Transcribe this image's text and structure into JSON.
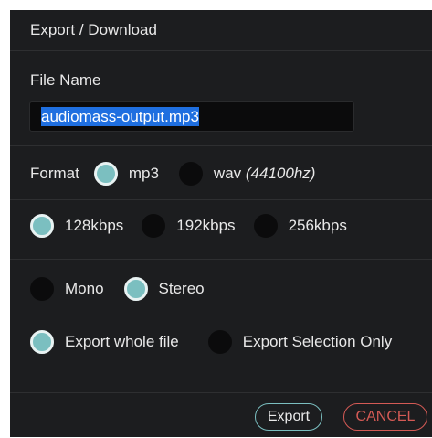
{
  "dialog": {
    "title": "Export / Download"
  },
  "file_name": {
    "label": "File Name",
    "value": "audiomass-output.mp3"
  },
  "format": {
    "label": "Format",
    "options": [
      {
        "label": "mp3",
        "selected": true
      },
      {
        "label": "wav",
        "suffix": "(44100hz)",
        "selected": false
      }
    ]
  },
  "bitrate": {
    "options": [
      {
        "label": "128kbps",
        "selected": true
      },
      {
        "label": "192kbps",
        "selected": false
      },
      {
        "label": "256kbps",
        "selected": false
      }
    ]
  },
  "channels": {
    "options": [
      {
        "label": "Mono",
        "selected": false
      },
      {
        "label": "Stereo",
        "selected": true
      }
    ]
  },
  "range": {
    "options": [
      {
        "label": "Export whole file",
        "selected": true
      },
      {
        "label": "Export Selection Only",
        "selected": false
      }
    ]
  },
  "buttons": {
    "export_label": "Export",
    "cancel_label": "CANCEL"
  },
  "colors": {
    "panel_bg": "#1c1d1f",
    "radio_selected": "#7bbfc0",
    "selection_highlight": "#1f6fe0",
    "cancel_red": "#d45a55"
  }
}
